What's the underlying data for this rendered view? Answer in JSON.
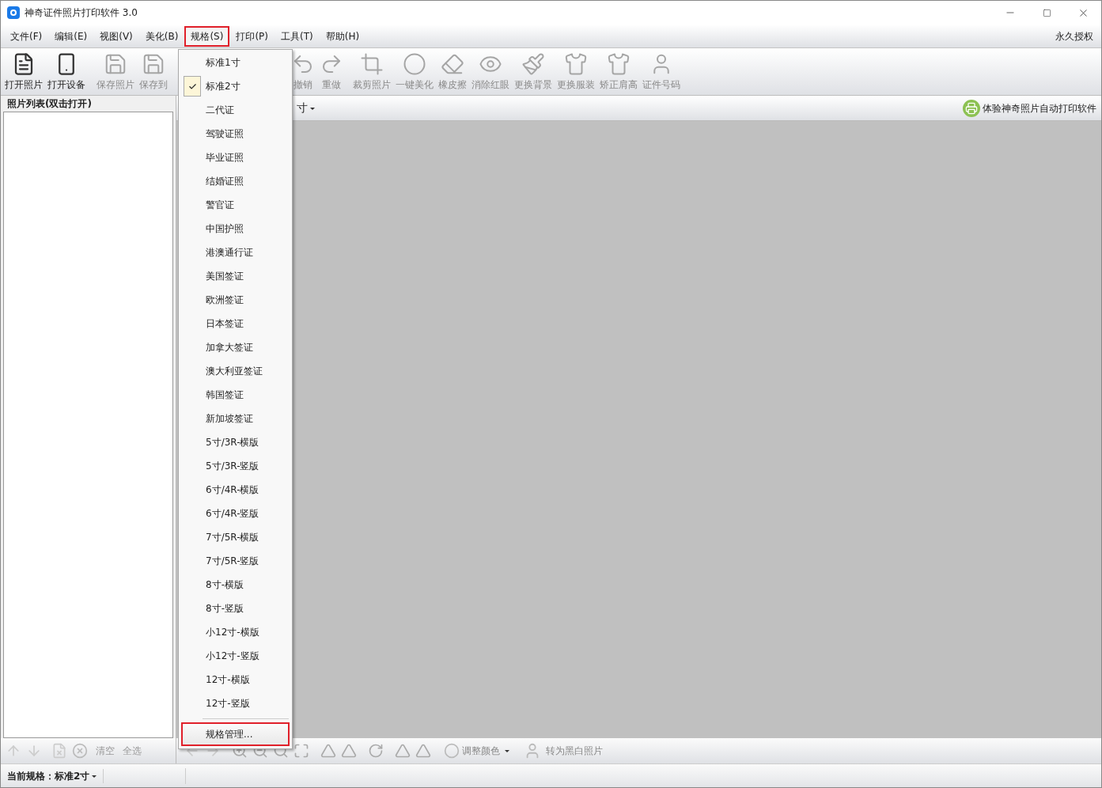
{
  "window": {
    "title": "神奇证件照片打印软件 3.0"
  },
  "menubar": {
    "items": [
      {
        "label": "文件(F)",
        "selected": false
      },
      {
        "label": "编辑(E)",
        "selected": false
      },
      {
        "label": "视图(V)",
        "selected": false
      },
      {
        "label": "美化(B)",
        "selected": false
      },
      {
        "label": "规格(S)",
        "selected": true
      },
      {
        "label": "打印(P)",
        "selected": false
      },
      {
        "label": "工具(T)",
        "selected": false
      },
      {
        "label": "帮助(H)",
        "selected": false
      }
    ],
    "license": "永久授权"
  },
  "toolbar": [
    {
      "label": "打开照片",
      "disabled": false
    },
    {
      "label": "打开设备",
      "disabled": false
    },
    {
      "label": "保存照片",
      "disabled": true
    },
    {
      "label": "保存到",
      "disabled": true
    },
    {
      "label": "撤销",
      "disabled": true
    },
    {
      "label": "重做",
      "disabled": true
    },
    {
      "label": "裁剪照片",
      "disabled": true
    },
    {
      "label": "一键美化",
      "disabled": true
    },
    {
      "label": "橡皮擦",
      "disabled": true
    },
    {
      "label": "消除红眼",
      "disabled": true
    },
    {
      "label": "更换背景",
      "disabled": true
    },
    {
      "label": "更换服装",
      "disabled": true
    },
    {
      "label": "矫正肩高",
      "disabled": true
    },
    {
      "label": "证件号码",
      "disabled": true
    }
  ],
  "photo_list": {
    "title": "照片列表(双击打开)",
    "actions": [
      "清空",
      "全选"
    ]
  },
  "canvas_header": {
    "size_label": "寸",
    "promo": "体验神奇照片自动打印软件"
  },
  "canvas_toolbar": {
    "adjust_color": "调整颜色",
    "grayscale": "转为黑白照片"
  },
  "spec_menu": {
    "items": [
      {
        "label": "标准1寸",
        "checked": false
      },
      {
        "label": "标准2寸",
        "checked": true
      },
      {
        "label": "二代证",
        "checked": false
      },
      {
        "label": "驾驶证照",
        "checked": false
      },
      {
        "label": "毕业证照",
        "checked": false
      },
      {
        "label": "结婚证照",
        "checked": false
      },
      {
        "label": "警官证",
        "checked": false
      },
      {
        "label": "中国护照",
        "checked": false
      },
      {
        "label": "港澳通行证",
        "checked": false
      },
      {
        "label": "美国签证",
        "checked": false
      },
      {
        "label": "欧洲签证",
        "checked": false
      },
      {
        "label": "日本签证",
        "checked": false
      },
      {
        "label": "加拿大签证",
        "checked": false
      },
      {
        "label": "澳大利亚签证",
        "checked": false
      },
      {
        "label": "韩国签证",
        "checked": false
      },
      {
        "label": "新加坡签证",
        "checked": false
      },
      {
        "label": "5寸/3R-横版",
        "checked": false
      },
      {
        "label": "5寸/3R-竖版",
        "checked": false
      },
      {
        "label": "6寸/4R-横版",
        "checked": false
      },
      {
        "label": "6寸/4R-竖版",
        "checked": false
      },
      {
        "label": "7寸/5R-横版",
        "checked": false
      },
      {
        "label": "7寸/5R-竖版",
        "checked": false
      },
      {
        "label": "8寸-横版",
        "checked": false
      },
      {
        "label": "8寸-竖版",
        "checked": false
      },
      {
        "label": "小12寸-横版",
        "checked": false
      },
      {
        "label": "小12寸-竖版",
        "checked": false
      },
      {
        "label": "12寸-横版",
        "checked": false
      },
      {
        "label": "12寸-竖版",
        "checked": false
      }
    ],
    "manage": {
      "label": "规格管理...",
      "highlighted": true
    }
  },
  "status_bar": {
    "label": "当前规格：",
    "value": "标准2寸"
  }
}
